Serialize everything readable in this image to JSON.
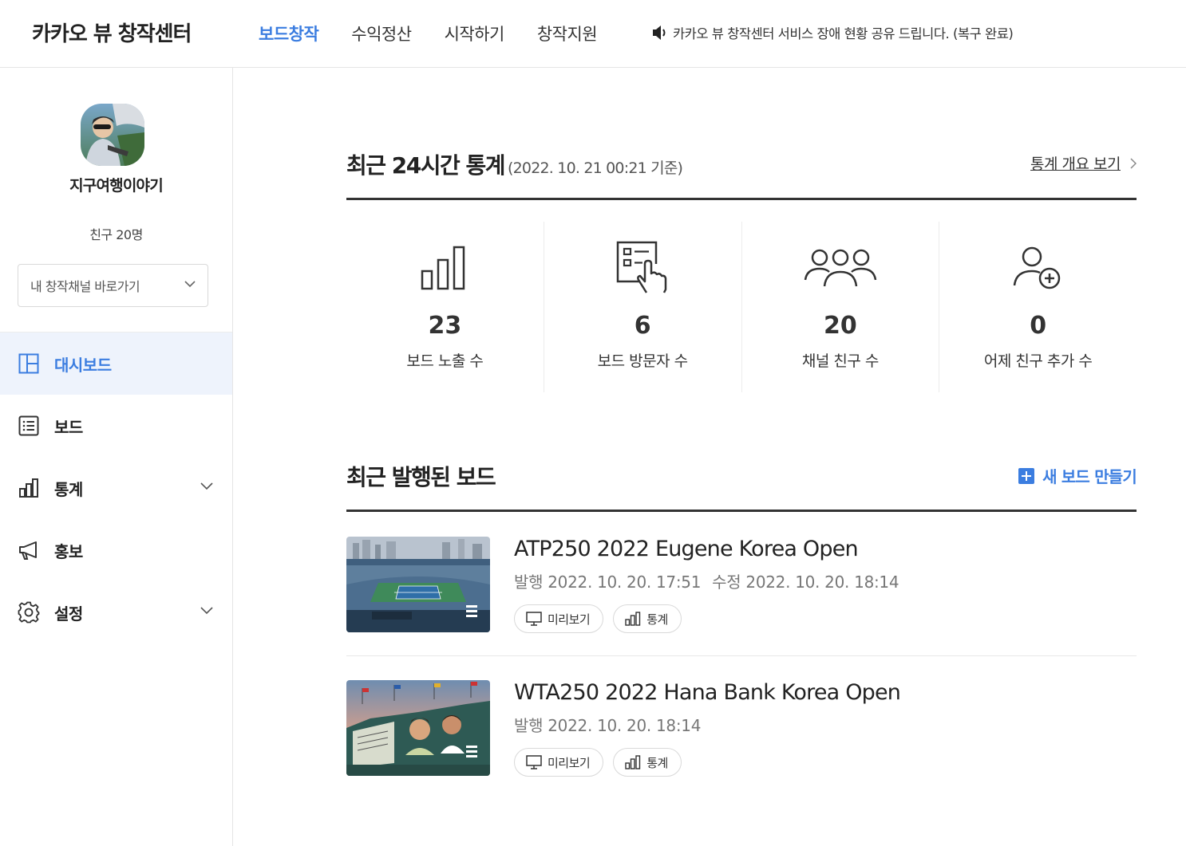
{
  "header": {
    "logo": "카카오 뷰 창작센터",
    "nav": [
      "보드창작",
      "수익정산",
      "시작하기",
      "창작지원"
    ],
    "active_nav": "보드창작",
    "notice": "카카오 뷰 창작센터 서비스 장애 현황 공유 드립니다. (복구 완료)",
    "notice_icon": "speaker-icon"
  },
  "sidebar": {
    "channel_name": "지구여행이야기",
    "friend_count": "친구 20명",
    "channel_select": "내 창작채널 바로가기",
    "menu": [
      {
        "label": "대시보드",
        "icon": "dashboard-icon",
        "active": true
      },
      {
        "label": "보드",
        "icon": "board-list-icon"
      },
      {
        "label": "통계",
        "icon": "stats-icon",
        "expandable": true
      },
      {
        "label": "홍보",
        "icon": "megaphone-icon"
      },
      {
        "label": "설정",
        "icon": "gear-icon",
        "expandable": true
      }
    ]
  },
  "stats_section": {
    "title": "최근 24시간 통계",
    "subtitle": "(2022. 10. 21 00:21 기준)",
    "link": "통계 개요 보기",
    "items": [
      {
        "value": "23",
        "label": "보드 노출 수",
        "icon": "bar-chart-icon"
      },
      {
        "value": "6",
        "label": "보드 방문자 수",
        "icon": "board-tap-icon"
      },
      {
        "value": "20",
        "label": "채널 친구 수",
        "icon": "group-icon"
      },
      {
        "value": "0",
        "label": "어제 친구 추가 수",
        "icon": "add-person-icon"
      }
    ]
  },
  "boards_section": {
    "title": "최근 발행된 보드",
    "new_button": "새 보드 만들기",
    "boards": [
      {
        "title": "ATP250 2022 Eugene Korea Open",
        "published": "발행 2022. 10. 20. 17:51",
        "modified": "수정 2022. 10. 20. 18:14",
        "preview_label": "미리보기",
        "stats_label": "통계"
      },
      {
        "title": "WTA250 2022 Hana Bank Korea Open",
        "published": "발행 2022. 10. 20. 18:14",
        "modified": "",
        "preview_label": "미리보기",
        "stats_label": "통계"
      }
    ]
  },
  "colors": {
    "accent": "#3b7de0",
    "active_bg": "#eef3fc",
    "text": "#222222",
    "muted": "#777777"
  }
}
